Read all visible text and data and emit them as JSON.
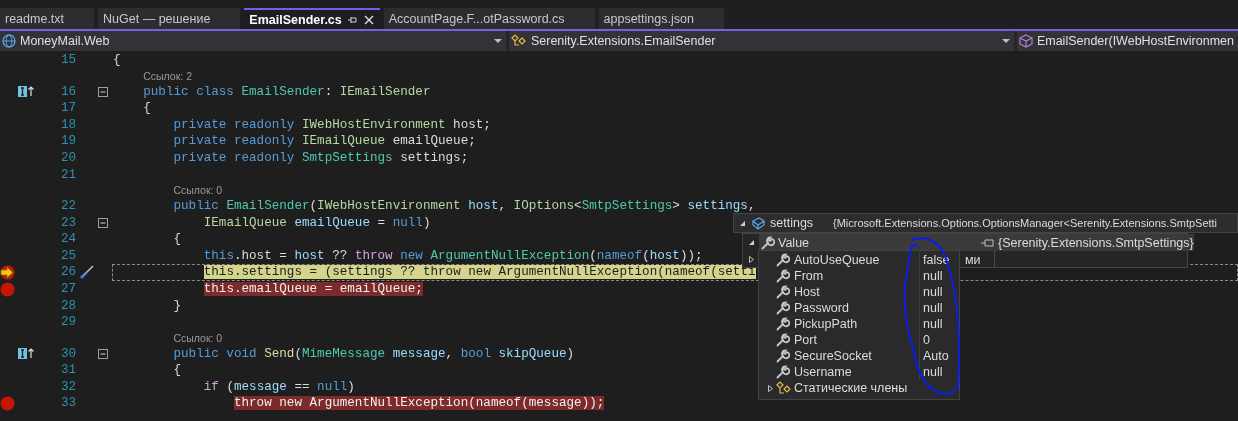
{
  "tabs": [
    {
      "label": "readme.txt",
      "selected": false
    },
    {
      "label": "NuGet — решение",
      "selected": false
    },
    {
      "label": "EmailSender.cs",
      "selected": true
    },
    {
      "label": "AccountPage.F...otPassword.cs",
      "selected": false
    },
    {
      "label": "appsettings.json",
      "selected": false
    }
  ],
  "nav_bar": {
    "project": "MoneyMail.Web",
    "type": "Serenity.Extensions.EmailSender",
    "member": "EmailSender(IWebHostEnvironmen"
  },
  "editor": {
    "lines": [
      {
        "kind": "code",
        "number": "15",
        "breakpoint": false,
        "current": false,
        "tokens": [
          {
            "kind": "p",
            "text": "{"
          }
        ]
      },
      {
        "kind": "lens",
        "text": "Ссылок: 2"
      },
      {
        "kind": "code",
        "number": "16",
        "breakpoint": false,
        "current": false,
        "implements": true,
        "fold": true,
        "tokens": [
          {
            "kind": "kw",
            "text": "    public class "
          },
          {
            "kind": "cls",
            "text": "EmailSender"
          },
          {
            "kind": "p",
            "text": ": "
          },
          {
            "kind": "ifc",
            "text": "IEmailSender"
          }
        ]
      },
      {
        "kind": "code",
        "number": "17",
        "breakpoint": false,
        "current": false,
        "tokens": [
          {
            "kind": "p",
            "text": "    {"
          }
        ]
      },
      {
        "kind": "code",
        "number": "18",
        "breakpoint": false,
        "current": false,
        "tokens": [
          {
            "kind": "kw",
            "text": "        private readonly "
          },
          {
            "kind": "ifc",
            "text": "IWebHostEnvironment"
          },
          {
            "kind": "id",
            "text": " host"
          },
          {
            "kind": "p",
            "text": ";"
          }
        ]
      },
      {
        "kind": "code",
        "number": "19",
        "breakpoint": false,
        "current": false,
        "tokens": [
          {
            "kind": "kw",
            "text": "        private readonly "
          },
          {
            "kind": "ifc",
            "text": "IEmailQueue"
          },
          {
            "kind": "id",
            "text": " emailQueue"
          },
          {
            "kind": "p",
            "text": ";"
          }
        ]
      },
      {
        "kind": "code",
        "number": "20",
        "breakpoint": false,
        "current": false,
        "tokens": [
          {
            "kind": "kw",
            "text": "        private readonly "
          },
          {
            "kind": "cls",
            "text": "SmtpSettings"
          },
          {
            "kind": "id",
            "text": " settings"
          },
          {
            "kind": "p",
            "text": ";"
          }
        ]
      },
      {
        "kind": "code",
        "number": "21"
      },
      {
        "kind": "lens",
        "text": "Ссылок: 0"
      },
      {
        "kind": "code",
        "number": "22",
        "breakpoint": false,
        "current": false,
        "tokens": [
          {
            "kind": "kw",
            "text": "        public "
          },
          {
            "kind": "cls",
            "text": "EmailSender"
          },
          {
            "kind": "p",
            "text": "("
          },
          {
            "kind": "ifc",
            "text": "IWebHostEnvironment"
          },
          {
            "kind": "prm",
            "text": " host"
          },
          {
            "kind": "p",
            "text": ", "
          },
          {
            "kind": "ifc",
            "text": "IOptions"
          },
          {
            "kind": "p",
            "text": "<"
          },
          {
            "kind": "cls",
            "text": "SmtpSettings"
          },
          {
            "kind": "p",
            "text": "> "
          },
          {
            "kind": "prm",
            "text": "settings"
          },
          {
            "kind": "p",
            "text": ","
          }
        ]
      },
      {
        "kind": "code",
        "number": "23",
        "breakpoint": false,
        "current": false,
        "fold": true,
        "tokens": [
          {
            "kind": "ifc",
            "text": "            IEmailQueue"
          },
          {
            "kind": "prm",
            "text": " emailQueue"
          },
          {
            "kind": "p",
            "text": " = "
          },
          {
            "kind": "kw",
            "text": "null"
          },
          {
            "kind": "p",
            "text": ")"
          }
        ]
      },
      {
        "kind": "code",
        "number": "24",
        "breakpoint": false,
        "current": false,
        "tokens": [
          {
            "kind": "p",
            "text": "        {"
          }
        ]
      },
      {
        "kind": "code",
        "number": "25",
        "breakpoint": false,
        "current": false,
        "tokens": [
          {
            "kind": "kw",
            "text": "            this"
          },
          {
            "kind": "id",
            "text": ".host"
          },
          {
            "kind": "p",
            "text": " = "
          },
          {
            "kind": "prm",
            "text": "host"
          },
          {
            "kind": "p",
            "text": " ?? "
          },
          {
            "kind": "ctl",
            "text": "throw"
          },
          {
            "kind": "kw",
            "text": " new "
          },
          {
            "kind": "cls",
            "text": "ArgumentNullException"
          },
          {
            "kind": "p",
            "text": "("
          },
          {
            "kind": "kw",
            "text": "nameof"
          },
          {
            "kind": "p",
            "text": "("
          },
          {
            "kind": "prm",
            "text": "host"
          },
          {
            "kind": "p",
            "text": "));"
          }
        ]
      },
      {
        "kind": "code",
        "number": "26",
        "breakpoint": true,
        "current": true,
        "edit_glyph": true,
        "tokens": [
          {
            "kind": "kw",
            "text": "            this"
          },
          {
            "kind": "id",
            "text": ".settings"
          },
          {
            "kind": "p",
            "text": " = ("
          },
          {
            "kind": "prm",
            "text": "settings"
          },
          {
            "kind": "p",
            "text": " ?? "
          },
          {
            "kind": "ctl",
            "text": "throw"
          },
          {
            "kind": "kw",
            "text": " new "
          },
          {
            "kind": "cls",
            "text": "ArgumentNullException"
          },
          {
            "kind": "p",
            "text": "("
          },
          {
            "kind": "kw",
            "text": "nameof"
          },
          {
            "kind": "p",
            "text": "("
          },
          {
            "kind": "prm",
            "text": "setti"
          }
        ]
      },
      {
        "kind": "code",
        "number": "27",
        "breakpoint": true,
        "current": false,
        "tokens": [
          {
            "kind": "kw",
            "text": "            this"
          },
          {
            "kind": "id",
            "text": ".emailQueue"
          },
          {
            "kind": "p",
            "text": " = "
          },
          {
            "kind": "prm",
            "text": "emailQueue"
          },
          {
            "kind": "p",
            "text": ";"
          }
        ]
      },
      {
        "kind": "code",
        "number": "28",
        "breakpoint": false,
        "current": false,
        "tokens": [
          {
            "kind": "p",
            "text": "        }"
          }
        ]
      },
      {
        "kind": "code",
        "number": "29"
      },
      {
        "kind": "lens",
        "text": "Ссылок: 0"
      },
      {
        "kind": "code",
        "number": "30",
        "breakpoint": false,
        "current": false,
        "implements": true,
        "fold": true,
        "tokens": [
          {
            "kind": "kw",
            "text": "        public void "
          },
          {
            "kind": "mth",
            "text": "Send"
          },
          {
            "kind": "p",
            "text": "("
          },
          {
            "kind": "cls",
            "text": "MimeMessage"
          },
          {
            "kind": "prm",
            "text": " message"
          },
          {
            "kind": "p",
            "text": ", "
          },
          {
            "kind": "kw",
            "text": "bool"
          },
          {
            "kind": "prm",
            "text": " skipQueue"
          },
          {
            "kind": "p",
            "text": ")"
          }
        ]
      },
      {
        "kind": "code",
        "number": "31",
        "breakpoint": false,
        "current": false,
        "tokens": [
          {
            "kind": "p",
            "text": "        {"
          }
        ]
      },
      {
        "kind": "code",
        "number": "32",
        "breakpoint": false,
        "current": false,
        "tokens": [
          {
            "kind": "ctl",
            "text": "            if"
          },
          {
            "kind": "p",
            "text": " ("
          },
          {
            "kind": "prm",
            "text": "message"
          },
          {
            "kind": "p",
            "text": " == "
          },
          {
            "kind": "kw",
            "text": "null"
          },
          {
            "kind": "p",
            "text": ")"
          }
        ]
      },
      {
        "kind": "code",
        "number": "33",
        "breakpoint": true,
        "current": false,
        "tokens": [
          {
            "kind": "ctl",
            "text": "                throw"
          },
          {
            "kind": "kw",
            "text": " new "
          },
          {
            "kind": "cls",
            "text": "ArgumentNullException"
          },
          {
            "kind": "p",
            "text": "("
          },
          {
            "kind": "kw",
            "text": "nameof"
          },
          {
            "kind": "p",
            "text": "("
          },
          {
            "kind": "prm",
            "text": "message"
          },
          {
            "kind": "p",
            "text": "));"
          }
        ]
      }
    ]
  },
  "datatip": {
    "name": "settings",
    "value": "{Microsoft.Extensions.Options.OptionsManager<Serenity.Extensions.SmtpSetti",
    "expanded": true,
    "children": [
      {
        "name": "Value",
        "value": "{Serenity.Extensions.SmtpSettings}",
        "expanded": true,
        "children": [
          {
            "kind": "property",
            "name": "AutoUseQueue",
            "value": "false"
          },
          {
            "kind": "property",
            "name": "From",
            "value": "null"
          },
          {
            "kind": "property",
            "name": "Host",
            "value": "null"
          },
          {
            "kind": "property",
            "name": "Password",
            "value": "null"
          },
          {
            "kind": "property",
            "name": "PickupPath",
            "value": "null"
          },
          {
            "kind": "property",
            "name": "Port",
            "value": "0"
          },
          {
            "kind": "property",
            "name": "SecureSocket",
            "value": "Auto"
          },
          {
            "kind": "property",
            "name": "Username",
            "value": "null"
          },
          {
            "kind": "static",
            "name": "Статические члены",
            "expanded": false
          }
        ]
      },
      {
        "name": "ми",
        "expanded": false
      }
    ]
  }
}
